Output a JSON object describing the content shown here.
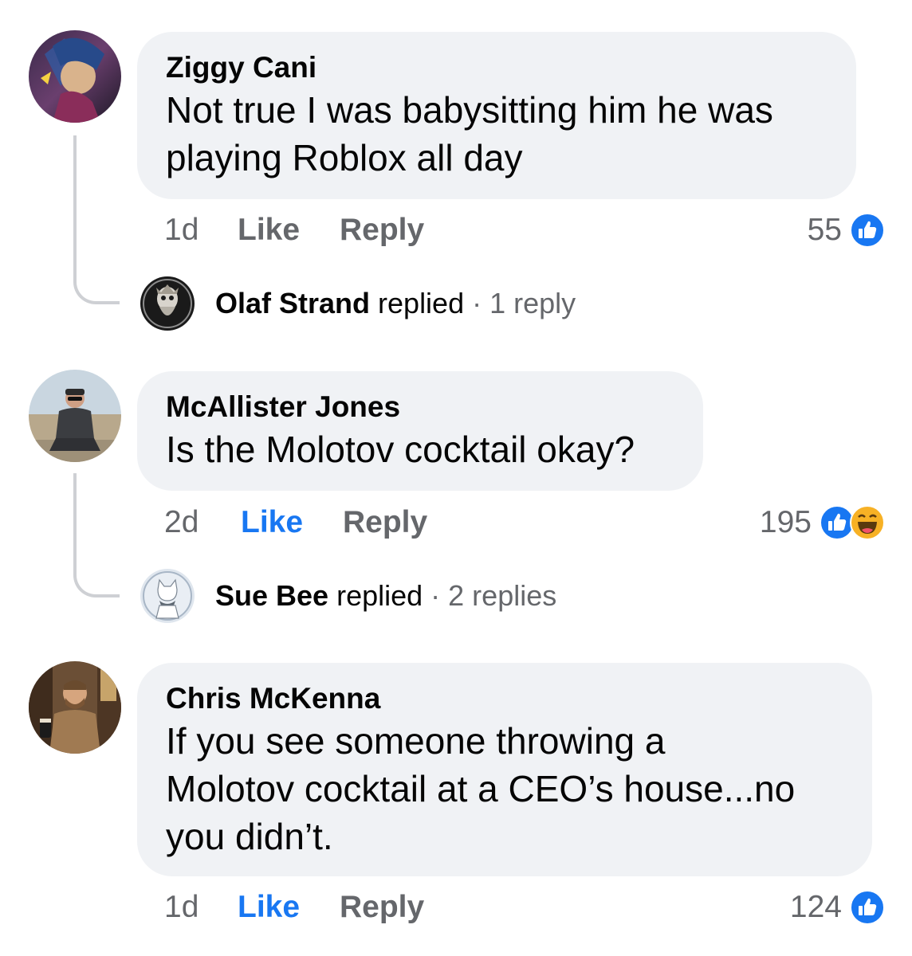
{
  "comments": [
    {
      "author": "Ziggy Cani",
      "text_lines": [
        "Not true I was babysitting him he was",
        "playing Roblox all day"
      ],
      "time": "1d",
      "like_label": "Like",
      "reply_label": "Reply",
      "reaction_count": "55",
      "reactions": [
        "like-icon"
      ],
      "reply_summary": {
        "name": "Olaf Strand",
        "verb": "replied",
        "separator": "·",
        "count": "1 reply"
      }
    },
    {
      "author": "McAllister Jones",
      "text_lines": [
        "Is the Molotov cocktail okay?"
      ],
      "time": "2d",
      "like_label": "Like",
      "reply_label": "Reply",
      "reaction_count": "195",
      "reactions": [
        "like-icon",
        "haha-icon"
      ],
      "reply_summary": {
        "name": "Sue Bee",
        "verb": "replied",
        "separator": "·",
        "count": "2 replies"
      }
    },
    {
      "author": "Chris McKenna",
      "text_lines": [
        "If you see someone throwing a",
        "Molotov cocktail at a CEO’s house...no",
        "you didn’t."
      ],
      "time": "1d",
      "like_label": "Like",
      "reply_label": "Reply",
      "reaction_count": "124",
      "reactions": [
        "like-icon"
      ]
    }
  ],
  "colors": {
    "bubble": "#f0f2f5",
    "secondary_text": "#65676b",
    "like_blue": "#1877f2",
    "thread_line": "#ced0d4"
  }
}
